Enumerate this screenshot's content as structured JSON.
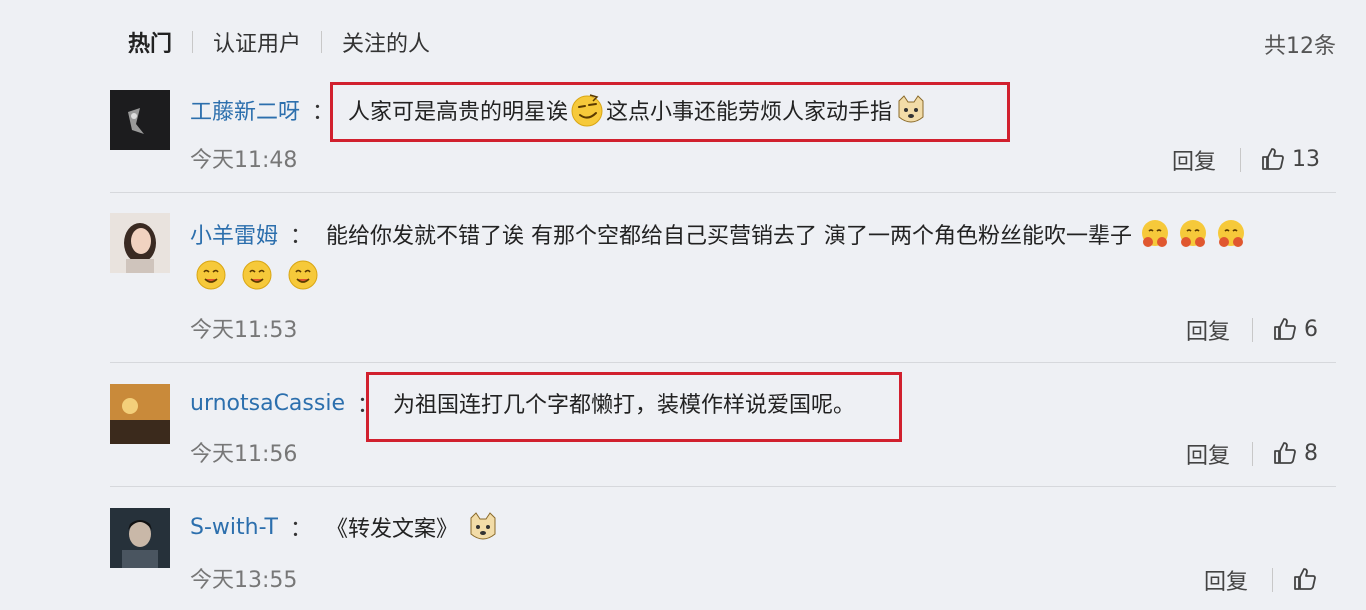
{
  "tabs": [
    {
      "label": "热门"
    },
    {
      "label": "认证用户"
    },
    {
      "label": "关注的人"
    }
  ],
  "total_count": "共12条",
  "comments": [
    {
      "username": "工藤新二呀",
      "colon": "：",
      "text_part1": "人家可是高贵的明星诶",
      "text_part2": "这点小事还能劳烦人家动手指",
      "time": "今天11:48",
      "reply_label": "回复",
      "likes": "13"
    },
    {
      "username": "小羊雷姆",
      "colon": "：",
      "text": "能给你发就不错了诶 有那个空都给自己买营销去了 演了一两个角色粉丝能吹一辈子",
      "time": "今天11:53",
      "reply_label": "回复",
      "likes": "6"
    },
    {
      "username": "urnotsaCassie",
      "colon": "：",
      "text": "为祖国连打几个字都懒打，装模作样说爱国呢。",
      "time": "今天11:56",
      "reply_label": "回复",
      "likes": "8"
    },
    {
      "username": "S-with-T",
      "colon": "：",
      "text": "《转发文案》",
      "time": "今天13:55",
      "reply_label": "回复",
      "likes": ""
    }
  ],
  "icons": {
    "like": "thumbs-up-icon",
    "emoji_smug": "smirk-emoji-icon",
    "emoji_dog": "doge-emoji-icon",
    "emoji_hug": "hug-emoji-icon",
    "emoji_yummy": "yummy-emoji-icon"
  },
  "colors": {
    "username": "#2c6fad",
    "highlight": "#d1202e",
    "background": "#eef0f4"
  }
}
